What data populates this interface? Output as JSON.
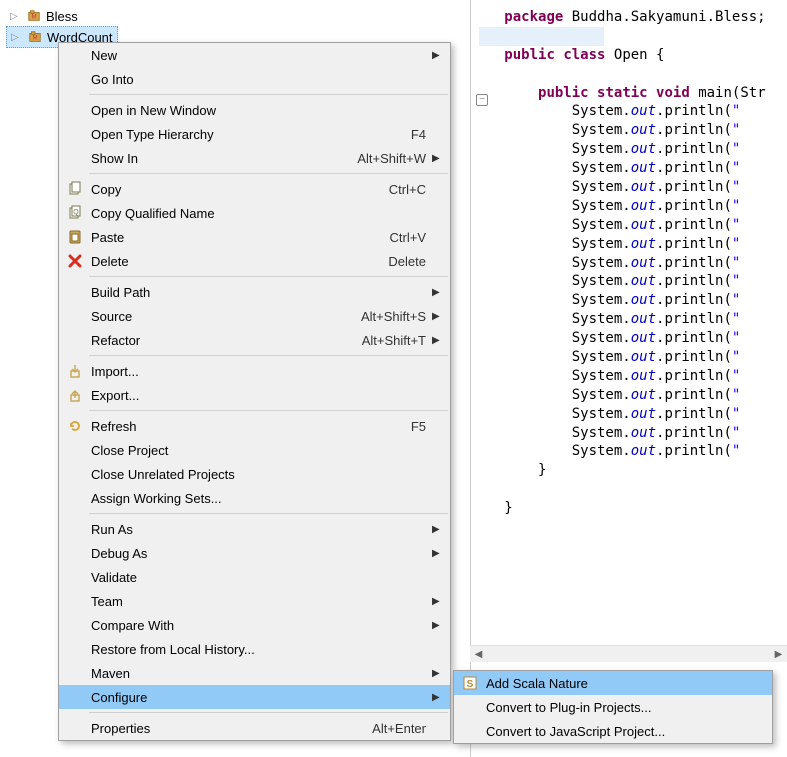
{
  "tree": {
    "items": [
      {
        "label": "Bless"
      },
      {
        "label": "WordCount"
      }
    ]
  },
  "menu": {
    "items": [
      {
        "label": "New",
        "arrow": true
      },
      {
        "label": "Go Into"
      },
      {
        "sep": true
      },
      {
        "label": "Open in New Window"
      },
      {
        "label": "Open Type Hierarchy",
        "shortcut": "F4"
      },
      {
        "label": "Show In",
        "shortcut": "Alt+Shift+W",
        "arrow": true
      },
      {
        "sep": true
      },
      {
        "label": "Copy",
        "shortcut": "Ctrl+C",
        "icon": "copy"
      },
      {
        "label": "Copy Qualified Name",
        "icon": "copyq"
      },
      {
        "label": "Paste",
        "shortcut": "Ctrl+V",
        "icon": "paste"
      },
      {
        "label": "Delete",
        "shortcut": "Delete",
        "icon": "delete"
      },
      {
        "sep": true
      },
      {
        "label": "Build Path",
        "arrow": true
      },
      {
        "label": "Source",
        "shortcut": "Alt+Shift+S",
        "arrow": true
      },
      {
        "label": "Refactor",
        "shortcut": "Alt+Shift+T",
        "arrow": true
      },
      {
        "sep": true
      },
      {
        "label": "Import...",
        "icon": "import"
      },
      {
        "label": "Export...",
        "icon": "export"
      },
      {
        "sep": true
      },
      {
        "label": "Refresh",
        "shortcut": "F5",
        "icon": "refresh"
      },
      {
        "label": "Close Project"
      },
      {
        "label": "Close Unrelated Projects"
      },
      {
        "label": "Assign Working Sets..."
      },
      {
        "sep": true
      },
      {
        "label": "Run As",
        "arrow": true
      },
      {
        "label": "Debug As",
        "arrow": true
      },
      {
        "label": "Validate"
      },
      {
        "label": "Team",
        "arrow": true
      },
      {
        "label": "Compare With",
        "arrow": true
      },
      {
        "label": "Restore from Local History..."
      },
      {
        "label": "Maven",
        "arrow": true
      },
      {
        "label": "Configure",
        "arrow": true,
        "highlighted": true
      },
      {
        "sep": true
      },
      {
        "label": "Properties",
        "shortcut": "Alt+Enter"
      }
    ]
  },
  "submenu": {
    "items": [
      {
        "label": "Add Scala Nature",
        "icon": "scala",
        "highlighted": true
      },
      {
        "label": "Convert to Plug-in Projects..."
      },
      {
        "label": "Convert to JavaScript Project..."
      }
    ]
  },
  "code": {
    "package_kw": "package",
    "package_name": " Buddha.Sakyamuni.Bless;",
    "public_kw": "public",
    "class_kw": "class",
    "class_name": " Open {",
    "static_kw": "static",
    "void_kw": "void",
    "main_sig": " main(Str",
    "sys": "System.",
    "out": "out",
    "println": ".println(",
    "quote": "\"",
    "brace": "}",
    "println_count": 19
  }
}
